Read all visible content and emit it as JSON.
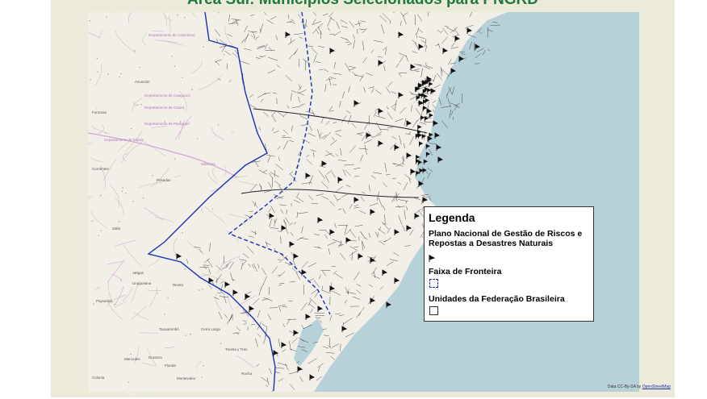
{
  "slide": {
    "title": "Área Sul: Municípios Selecionados para PNGRD"
  },
  "map": {
    "place_labels": [
      "Asunción",
      "Formosa",
      "Corrientes",
      "Posadas",
      "Uruguaiana",
      "Tacuarembó",
      "Rivera",
      "Mercedes",
      "Montevideo",
      "Departamento de Canindeyú",
      "Departamento de Caaguazú",
      "Departamento de Guairá",
      "Departamento de Paraguarí",
      "Departamento de Itapúa",
      "Misiones",
      "Salto",
      "Artigas",
      "Paysandú",
      "Durazno",
      "Florida",
      "Colonia",
      "Treinta y Tres",
      "Cerro Largo",
      "Rocha"
    ],
    "colors": {
      "ocean": "#b7d1d8",
      "land": "#f1efe8",
      "municipality_lines": "#3a3a3a",
      "frontier_dash": "#1a2fb8",
      "markers": "#111111",
      "neighbor_text": "#b07ab8"
    },
    "attribution_text": "Data CC-By-SA by ",
    "attribution_link": "OpenStreetMap"
  },
  "legend": {
    "title": "Legenda",
    "item1_label": "Plano Nacional de Gestão de Riscos e\n Repostas a Desastres Naturais",
    "item1_icon": "disaster-flag-icon",
    "item2_label": "Faixa de Fronteira",
    "item2_icon": "dashed-blue-square-icon",
    "item3_label": "Unidades da Federação Brasileira",
    "item3_icon": "white-square-icon"
  }
}
